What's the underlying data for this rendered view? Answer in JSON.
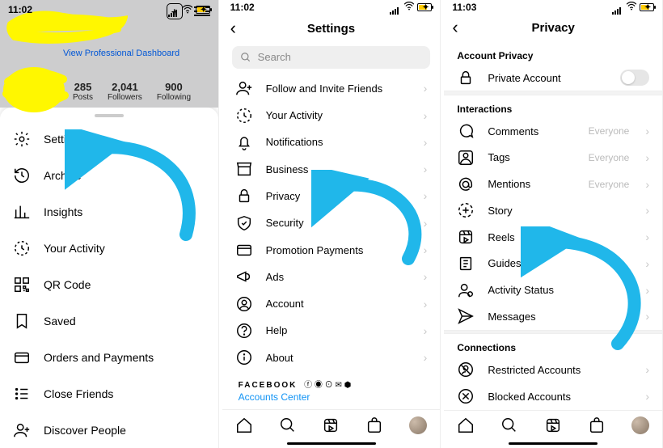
{
  "status": {
    "time1": "11:02",
    "time2": "11:02",
    "time3": "11:03"
  },
  "screen1": {
    "dash_link": "View Professional Dashboard",
    "stats": [
      {
        "n": "285",
        "l": "Posts"
      },
      {
        "n": "2,041",
        "l": "Followers"
      },
      {
        "n": "900",
        "l": "Following"
      }
    ],
    "menu": [
      {
        "label": "Settings",
        "icon": "gear"
      },
      {
        "label": "Archive",
        "icon": "archive"
      },
      {
        "label": "Insights",
        "icon": "insights"
      },
      {
        "label": "Your Activity",
        "icon": "activity"
      },
      {
        "label": "QR Code",
        "icon": "qr"
      },
      {
        "label": "Saved",
        "icon": "bookmark"
      },
      {
        "label": "Orders and Payments",
        "icon": "card"
      },
      {
        "label": "Close Friends",
        "icon": "list"
      },
      {
        "label": "Discover People",
        "icon": "adduser"
      }
    ]
  },
  "screen2": {
    "title": "Settings",
    "search_placeholder": "Search",
    "items": [
      {
        "label": "Follow and Invite Friends",
        "icon": "adduser"
      },
      {
        "label": "Your Activity",
        "icon": "activity"
      },
      {
        "label": "Notifications",
        "icon": "bell"
      },
      {
        "label": "Business",
        "icon": "shop"
      },
      {
        "label": "Privacy",
        "icon": "lock"
      },
      {
        "label": "Security",
        "icon": "shield"
      },
      {
        "label": "Promotion Payments",
        "icon": "card"
      },
      {
        "label": "Ads",
        "icon": "megaphone"
      },
      {
        "label": "Account",
        "icon": "account"
      },
      {
        "label": "Help",
        "icon": "help"
      },
      {
        "label": "About",
        "icon": "info"
      }
    ],
    "fb_brand": "FACEBOOK",
    "fb_icons": "",
    "accounts_center": "Accounts Center"
  },
  "screen3": {
    "title": "Privacy",
    "sec_account": "Account Privacy",
    "private_account": "Private Account",
    "sec_interactions": "Interactions",
    "items": [
      {
        "label": "Comments",
        "sub": "Everyone",
        "icon": "comment"
      },
      {
        "label": "Tags",
        "sub": "Everyone",
        "icon": "tag"
      },
      {
        "label": "Mentions",
        "sub": "Everyone",
        "icon": "mention"
      },
      {
        "label": "Story",
        "sub": "",
        "icon": "story"
      },
      {
        "label": "Reels",
        "sub": "",
        "icon": "reels"
      },
      {
        "label": "Guides",
        "sub": "",
        "icon": "guides"
      },
      {
        "label": "Activity Status",
        "sub": "",
        "icon": "status"
      },
      {
        "label": "Messages",
        "sub": "",
        "icon": "send"
      }
    ],
    "sec_connections": "Connections",
    "restricted": "Restricted Accounts",
    "blocked": "Blocked Accounts"
  }
}
